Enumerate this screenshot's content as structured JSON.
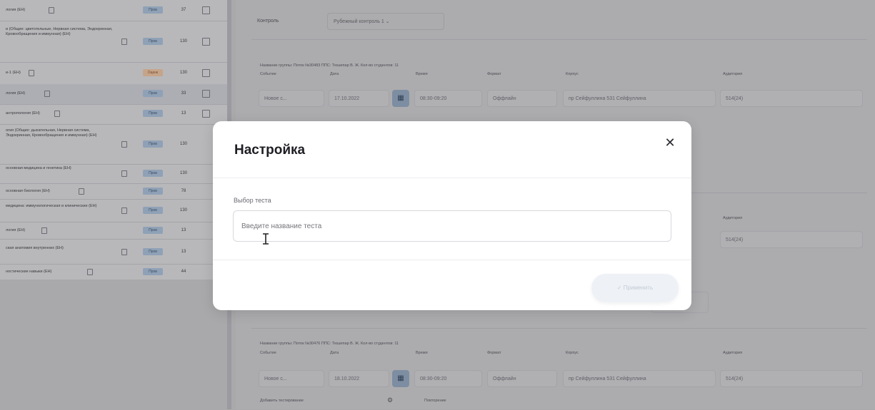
{
  "left_table": {
    "rows": [
      {
        "name": "логия (ЕН)",
        "badge": "Пров",
        "num": "37",
        "badge_warn": false
      },
      {
        "name": "и (Общие: цветотельные, Нервная система, Эндокринная, Кровообращения и иммунная) (ЕН)",
        "badge": "Пров",
        "num": "130",
        "badge_warn": false
      },
      {
        "name": "и-1 (ЕН)",
        "badge": "Оценк",
        "num": "130",
        "badge_warn": true
      },
      {
        "name": "логия (ЕН)",
        "badge": "Пров",
        "num": "33",
        "badge_warn": false
      },
      {
        "name": "антропология (ЕН)",
        "badge": "Пров",
        "num": "13",
        "badge_warn": false
      },
      {
        "name": "огия (Общие: дыхательная, Нервная система, Эндокринная, Кровообращения и иммунная) (ЕН)",
        "badge": "Пров",
        "num": "130",
        "badge_warn": false
      },
      {
        "name": "основная медицина и генетика (ЕН)",
        "badge": "Пров",
        "num": "130",
        "badge_warn": false
      },
      {
        "name": "основная биология (ЕН)",
        "badge": "Пров",
        "num": "78",
        "badge_warn": false
      },
      {
        "name": "медицина: иммунологическая и клинические (ЕН)",
        "badge": "Пров",
        "num": "130",
        "badge_warn": false
      },
      {
        "name": "логия (ЕН)",
        "badge": "Пров",
        "num": "13",
        "badge_warn": false
      },
      {
        "name": "ская анатомия внутренних (ЕН)",
        "badge": "Пров",
        "num": "13",
        "badge_warn": false
      },
      {
        "name": "ностические навыки (ЕН)",
        "badge": "Пров",
        "num": "44",
        "badge_warn": false
      }
    ]
  },
  "form": {
    "control_label": "Контроль",
    "control_value": "Рубежный контроль 1",
    "group1": {
      "meta": "Название группы: Поток №30483    ППС: Тюшепар В. Ж.    Кол-во студентов: 11",
      "labels": {
        "event": "Событие",
        "date": "Дата",
        "time": "Время",
        "format": "Формат",
        "building": "Корпус",
        "room": "Аудитория"
      },
      "event": "Новое с...",
      "date": "17.10.2022",
      "time": "08:30-09:20",
      "format": "Оффлайн",
      "building": "пр Сейфуллина 531 Сейфуллина",
      "room": "514(24)"
    },
    "group2": {
      "room": "514(24)",
      "room_label": "Аудитория"
    },
    "group3": {
      "meta": "Название группы: Поток №30476    ППС: Тюшепар В. Ж.    Кол-во студентов: 11",
      "labels": {
        "event": "Событие",
        "date": "Дата",
        "time": "Время",
        "format": "Формат",
        "building": "Корпус",
        "room": "Аудитория"
      },
      "event": "Новое с...",
      "date": "18.10.2022",
      "time": "08:30-09:20",
      "format": "Оффлайн",
      "building": "пр Сейфуллина 531 Сейфуллина",
      "room": "514(24)",
      "add_tests": "Добавить тестирование",
      "repeat": "Повторение"
    }
  },
  "modal": {
    "title": "Настройка",
    "field_label": "Выбор теста",
    "placeholder": "Введите название теста",
    "apply": "Применить"
  }
}
